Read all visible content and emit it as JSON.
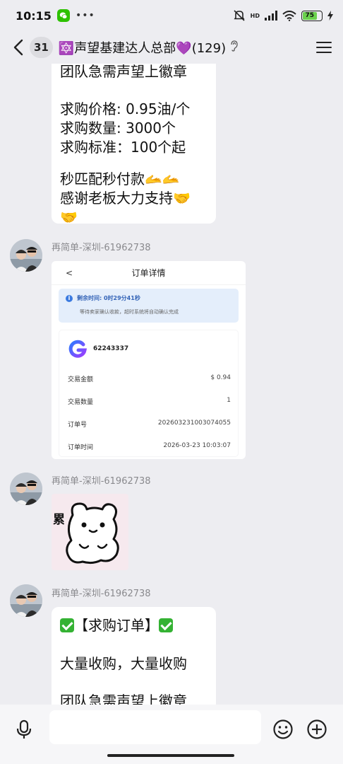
{
  "status_bar": {
    "time": "10:15",
    "dots": "•••",
    "hd": "HD",
    "battery": "75"
  },
  "header": {
    "unread": "31",
    "title": "🔯声望基建达人总部💜(129)"
  },
  "messages": {
    "first_bubble": {
      "partial_line": "团队急需声望上徽章",
      "lines": [
        "求购价格: 0.95油/个",
        "求购数量: 3000个",
        "求购标准：100个起"
      ],
      "closing": [
        "秒匹配秒付款🫴🫴",
        "感谢老板大力支持🤝🤝"
      ]
    },
    "msg2": {
      "sender": "再简单-深圳-61962738",
      "order": {
        "back": "<",
        "title": "订单详情",
        "remaining_label": "剩余时间: 0时29分41秒",
        "remaining_sub": "等待卖家确认收款，超时系统将自动确认完成",
        "user_id": "62243337",
        "rows": [
          {
            "label": "交易金额",
            "value": "$ 0.94"
          },
          {
            "label": "交易数量",
            "value": "1"
          },
          {
            "label": "订单号",
            "value": "202603231003074055"
          },
          {
            "label": "订单时间",
            "value": "2026-03-23 10:03:07"
          }
        ]
      }
    },
    "msg3": {
      "sender": "再简单-深圳-61962738",
      "sticker_text": "累"
    },
    "msg4": {
      "sender": "再简单-深圳-61962738",
      "heading": "【求购订单】",
      "line1": "大量收购，大量收购",
      "partial": "团队急需声望上徽章"
    }
  }
}
